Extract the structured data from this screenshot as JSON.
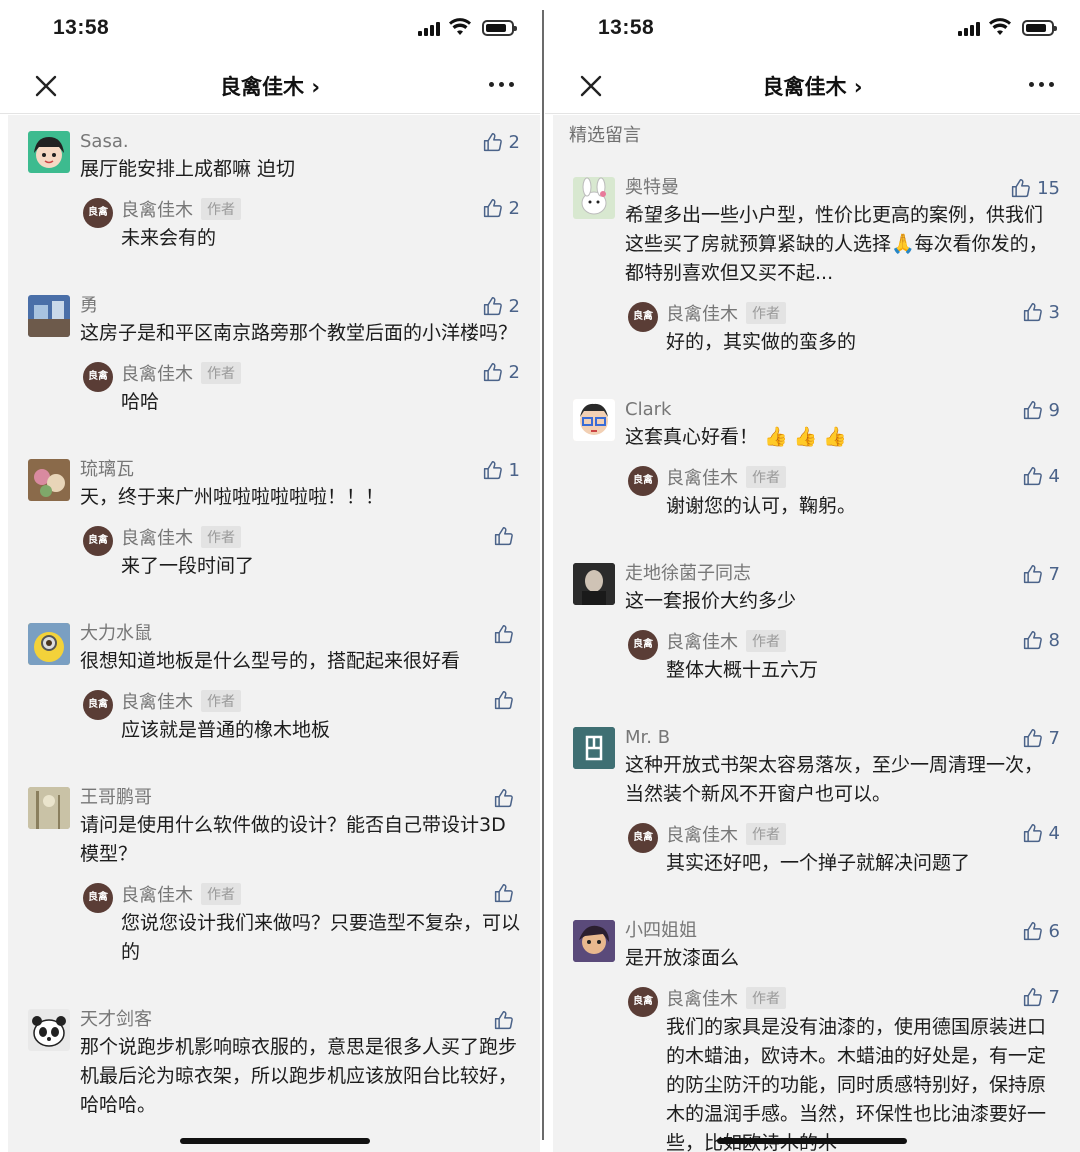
{
  "status": {
    "time": "13:58"
  },
  "nav": {
    "title": "良禽佳木 ›"
  },
  "author": {
    "name": "良禽佳木",
    "tag": "作者",
    "logo": "良禽"
  },
  "left": {
    "comments": [
      {
        "name": "Sasa.",
        "text": "展厅能安排上成都嘛 迫切",
        "likes": "2",
        "avatar_color": "#3dbb8f",
        "reply": {
          "text": "未来会有的",
          "likes": "2"
        }
      },
      {
        "name": "勇",
        "text": "这房子是和平区南京路旁那个教堂后面的小洋楼吗？",
        "likes": "2",
        "avatar_color": "#4a6fa8",
        "reply": {
          "text": "哈哈",
          "likes": "2"
        }
      },
      {
        "name": "琉璃瓦",
        "text": "天，终于来广州啦啦啦啦啦啦！！！",
        "likes": "1",
        "avatar_color": "#8a6a4a",
        "reply": {
          "text": "来了一段时间了",
          "likes": ""
        }
      },
      {
        "name": "大力水鼠",
        "text": "很想知道地板是什么型号的，搭配起来很好看",
        "likes": "",
        "avatar_color": "#e8c233",
        "reply": {
          "text": "应该就是普通的橡木地板",
          "likes": ""
        }
      },
      {
        "name": "王哥鹏哥",
        "text": "请问是使用什么软件做的设计？能否自己带设计3D模型？",
        "likes": "",
        "avatar_color": "#b8ae8e",
        "reply": {
          "text": "您说您设计我们来做吗？只要造型不复杂，可以的",
          "likes": ""
        }
      },
      {
        "name": "天才剑客",
        "text": "那个说跑步机影响晾衣服的，意思是很多人买了跑步机最后沦为晾衣架，所以跑步机应该放阳台比较好，哈哈哈。",
        "likes": "",
        "avatar_color": "#e9e9e9",
        "reply": null
      }
    ]
  },
  "right": {
    "section_label": "精选留言",
    "comments": [
      {
        "name": "奥特曼",
        "text": "希望多出一些小户型，性价比更高的案例，供我们这些买了房就预算紧缺的人选择🙏每次看你发的，都特别喜欢但又买不起...",
        "likes": "15",
        "avatar_color": "#d8e8d0",
        "reply": {
          "text": "好的，其实做的蛮多的",
          "likes": "3"
        }
      },
      {
        "name": "Clark",
        "text": "这套真心好看！ 👍 👍 👍",
        "likes": "9",
        "avatar_color": "#f0d9c0",
        "reply": {
          "text": "谢谢您的认可，鞠躬。",
          "likes": "4"
        }
      },
      {
        "name": "走地徐菌子同志",
        "text": "这一套报价大约多少",
        "likes": "7",
        "avatar_color": "#3a3a3a",
        "reply": {
          "text": "整体大概十五六万",
          "likes": "8"
        }
      },
      {
        "name": "Mr. B",
        "text": "这种开放式书架太容易落灰，至少一周清理一次，当然装个新风不开窗户也可以。",
        "likes": "7",
        "avatar_color": "#3f6f73",
        "reply": {
          "text": "其实还好吧，一个掸子就解决问题了",
          "likes": "4"
        }
      },
      {
        "name": "小四姐姐",
        "text": "是开放漆面么",
        "likes": "6",
        "avatar_color": "#6a4a8a",
        "reply": {
          "text": "我们的家具是没有油漆的，使用德国原装进口的木蜡油，欧诗木。木蜡油的好处是，有一定的防尘防汗的功能，同时质感特别好，保持原木的温润手感。当然，环保性也比油漆要好一些，比如欧诗木的木",
          "likes": "7"
        }
      }
    ]
  }
}
